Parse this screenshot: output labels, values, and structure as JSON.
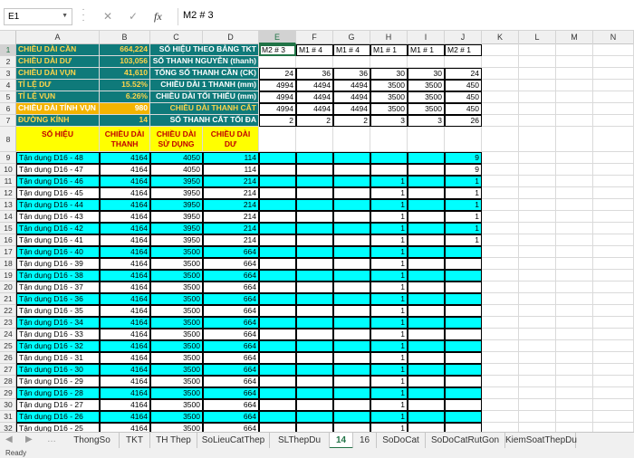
{
  "formula_bar": {
    "name_box": "E1",
    "value": "M2 # 3",
    "fx": "fx",
    "cancel": "✕",
    "confirm": "✓"
  },
  "columns": [
    "A",
    "B",
    "C",
    "D",
    "E",
    "F",
    "G",
    "H",
    "I",
    "J",
    "K",
    "L",
    "M",
    "N"
  ],
  "rows": [
    "1",
    "2",
    "3",
    "4",
    "5",
    "6",
    "7",
    "8",
    "9",
    "10",
    "11",
    "12",
    "13",
    "14",
    "15",
    "16",
    "17",
    "18",
    "19",
    "20",
    "21",
    "22",
    "23",
    "24",
    "25",
    "26",
    "27",
    "28",
    "29",
    "30",
    "31",
    "32"
  ],
  "summary": {
    "labels": [
      "CHIỀU DÀI CẦN",
      "CHIỀU DÀI DƯ",
      "CHIỀU DÀI VỤN",
      "TỈ LỆ DƯ",
      "TỈ LỆ VỤN",
      "CHIỀU DÀI TÍNH VỤN",
      "ĐƯỜNG KÍNH"
    ],
    "values": [
      "664,224",
      "103,056",
      "41,610",
      "15.52%",
      "6.26%",
      "980",
      "14"
    ]
  },
  "params": {
    "labels": [
      "SỐ HIỆU THEO BẢNG TKT",
      "SỐ THANH NGUYÊN (thanh)",
      "TỔNG SỐ THANH CẦN (CK)",
      "CHIỀU DÀI 1 THANH (mm)",
      "CHIỀU DÀI TỐI THIỂU (mm)",
      "CHIỀU DÀI THANH CẮT",
      "SỐ THANH CẮT TỐI ĐA"
    ],
    "cols": [
      [
        "M2 # 3",
        "",
        "24",
        "4994",
        "4994",
        "4994",
        "2"
      ],
      [
        "M1 # 4",
        "",
        "36",
        "4494",
        "4494",
        "4494",
        "2"
      ],
      [
        "M1 # 4",
        "",
        "36",
        "4494",
        "4494",
        "4494",
        "2"
      ],
      [
        "M1 # 1",
        "",
        "30",
        "3500",
        "3500",
        "3500",
        "3"
      ],
      [
        "M1 # 1",
        "",
        "30",
        "3500",
        "3500",
        "3500",
        "3"
      ],
      [
        "M2 # 1",
        "",
        "24",
        "450",
        "450",
        "450",
        "26"
      ]
    ]
  },
  "table_header": {
    "so_hieu": "SỐ HIỆU",
    "chieu_dai_thanh": "CHIỀU DÀI THANH",
    "chieu_dai_su_dung": "CHIỀU DÀI SỬ DỤNG",
    "chieu_dai_du": "CHIỀU DÀI DƯ"
  },
  "table_rows": [
    {
      "name": "Tận dụng D16 - 48",
      "len": "4164",
      "used": "4050",
      "rest": "114",
      "h": "",
      "j": "9"
    },
    {
      "name": "Tận dụng D16 - 47",
      "len": "4164",
      "used": "4050",
      "rest": "114",
      "h": "",
      "j": "9"
    },
    {
      "name": "Tận dụng D16 - 46",
      "len": "4164",
      "used": "3950",
      "rest": "214",
      "h": "1",
      "j": "1"
    },
    {
      "name": "Tận dụng D16 - 45",
      "len": "4164",
      "used": "3950",
      "rest": "214",
      "h": "1",
      "j": "1"
    },
    {
      "name": "Tận dụng D16 - 44",
      "len": "4164",
      "used": "3950",
      "rest": "214",
      "h": "1",
      "j": "1"
    },
    {
      "name": "Tận dụng D16 - 43",
      "len": "4164",
      "used": "3950",
      "rest": "214",
      "h": "1",
      "j": "1"
    },
    {
      "name": "Tận dụng D16 - 42",
      "len": "4164",
      "used": "3950",
      "rest": "214",
      "h": "1",
      "j": "1"
    },
    {
      "name": "Tận dụng D16 - 41",
      "len": "4164",
      "used": "3950",
      "rest": "214",
      "h": "1",
      "j": "1"
    },
    {
      "name": "Tận dụng D16 - 40",
      "len": "4164",
      "used": "3500",
      "rest": "664",
      "h": "1",
      "j": ""
    },
    {
      "name": "Tận dụng D16 - 39",
      "len": "4164",
      "used": "3500",
      "rest": "664",
      "h": "1",
      "j": ""
    },
    {
      "name": "Tận dụng D16 - 38",
      "len": "4164",
      "used": "3500",
      "rest": "664",
      "h": "1",
      "j": ""
    },
    {
      "name": "Tận dụng D16 - 37",
      "len": "4164",
      "used": "3500",
      "rest": "664",
      "h": "1",
      "j": ""
    },
    {
      "name": "Tận dụng D16 - 36",
      "len": "4164",
      "used": "3500",
      "rest": "664",
      "h": "1",
      "j": ""
    },
    {
      "name": "Tận dụng D16 - 35",
      "len": "4164",
      "used": "3500",
      "rest": "664",
      "h": "1",
      "j": ""
    },
    {
      "name": "Tận dụng D16 - 34",
      "len": "4164",
      "used": "3500",
      "rest": "664",
      "h": "1",
      "j": ""
    },
    {
      "name": "Tận dụng D16 - 33",
      "len": "4164",
      "used": "3500",
      "rest": "664",
      "h": "1",
      "j": ""
    },
    {
      "name": "Tận dụng D16 - 32",
      "len": "4164",
      "used": "3500",
      "rest": "664",
      "h": "1",
      "j": ""
    },
    {
      "name": "Tận dụng D16 - 31",
      "len": "4164",
      "used": "3500",
      "rest": "664",
      "h": "1",
      "j": ""
    },
    {
      "name": "Tận dụng D16 - 30",
      "len": "4164",
      "used": "3500",
      "rest": "664",
      "h": "1",
      "j": ""
    },
    {
      "name": "Tận dụng D16 - 29",
      "len": "4164",
      "used": "3500",
      "rest": "664",
      "h": "1",
      "j": ""
    },
    {
      "name": "Tận dụng D16 - 28",
      "len": "4164",
      "used": "3500",
      "rest": "664",
      "h": "1",
      "j": ""
    },
    {
      "name": "Tận dụng D16 - 27",
      "len": "4164",
      "used": "3500",
      "rest": "664",
      "h": "1",
      "j": ""
    },
    {
      "name": "Tận dụng D16 - 26",
      "len": "4164",
      "used": "3500",
      "rest": "664",
      "h": "1",
      "j": ""
    },
    {
      "name": "Tận dụng D16 - 25",
      "len": "4164",
      "used": "3500",
      "rest": "664",
      "h": "1",
      "j": ""
    }
  ],
  "sheet_tabs": [
    "ThongSo",
    "TKT",
    "TH Thep",
    "SoLieuCatThep",
    "SLThepDu",
    "14",
    "16",
    "SoDoCat",
    "SoDoCatRutGon",
    "KiemSoatThepDu"
  ],
  "active_tab": "14",
  "status": "Ready",
  "colors": {
    "teal": "#0f7a7a",
    "label_yellow": "#ffd54a",
    "orange": "#f4b400",
    "cyan": "#00ffff",
    "header_yellow": "#ffff00",
    "excel_green": "#217346"
  }
}
